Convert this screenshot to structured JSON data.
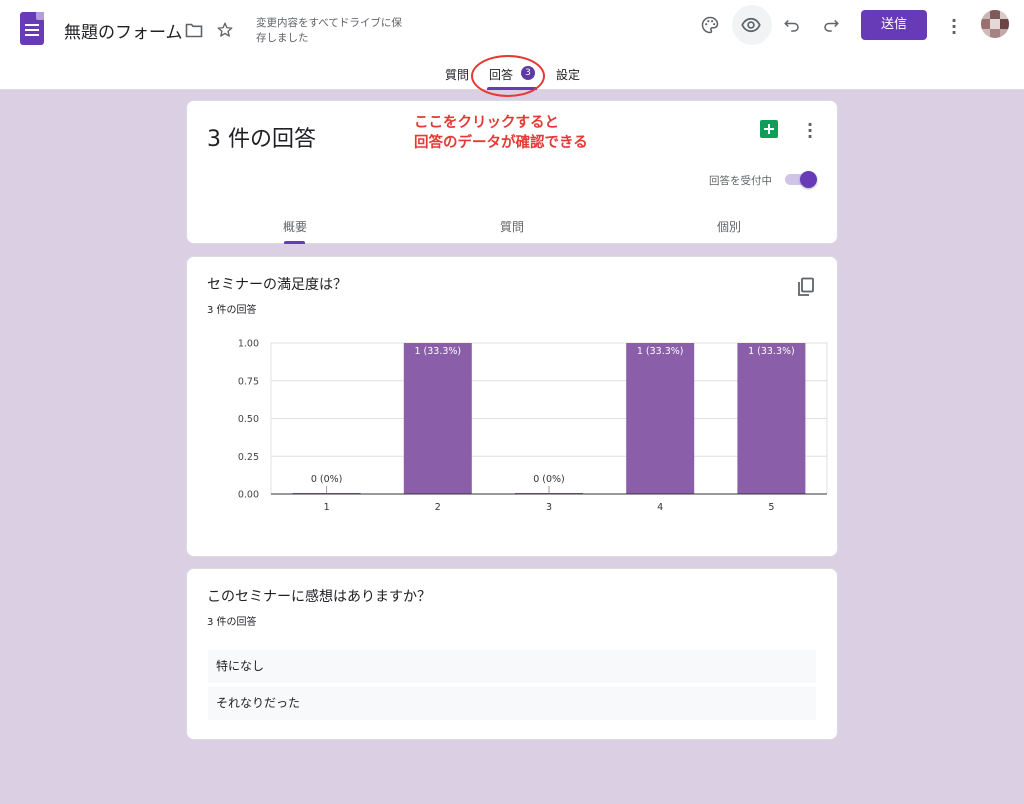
{
  "header": {
    "title": "無題のフォーム",
    "save_status": "変更内容をすべてドライブに保存しました",
    "send_label": "送信"
  },
  "tabs": {
    "questions": "質問",
    "responses": "回答",
    "responses_count": "3",
    "settings": "設定"
  },
  "summary": {
    "title": "3 件の回答",
    "annotation_line1": "ここをクリックすると",
    "annotation_line2": "回答のデータが確認できる",
    "accepting_label": "回答を受付中",
    "accepting_on": true,
    "subtabs": [
      "概要",
      "質問",
      "個別"
    ]
  },
  "question1": {
    "title": "セミナーの満足度は？",
    "count": "3 件の回答"
  },
  "chart_data": {
    "type": "bar",
    "categories": [
      "1",
      "2",
      "3",
      "4",
      "5"
    ],
    "values": [
      0,
      1,
      0,
      1,
      1
    ],
    "labels": [
      "0 (0%)",
      "1 (33.3%)",
      "0 (0%)",
      "1 (33.3%)",
      "1 (33.3%)"
    ],
    "ylim": [
      0,
      1
    ],
    "yticks": [
      "0.00",
      "0.25",
      "0.50",
      "0.75",
      "1.00"
    ],
    "grid": true,
    "color": "#8a5ea8"
  },
  "question2": {
    "title": "このセミナーに感想はありますか？",
    "count": "3 件の回答",
    "answers": [
      "特になし",
      "それなりだった"
    ]
  },
  "colors": {
    "accent": "#673ab7",
    "background": "#dbcfe4",
    "annotation": "#e53935"
  }
}
